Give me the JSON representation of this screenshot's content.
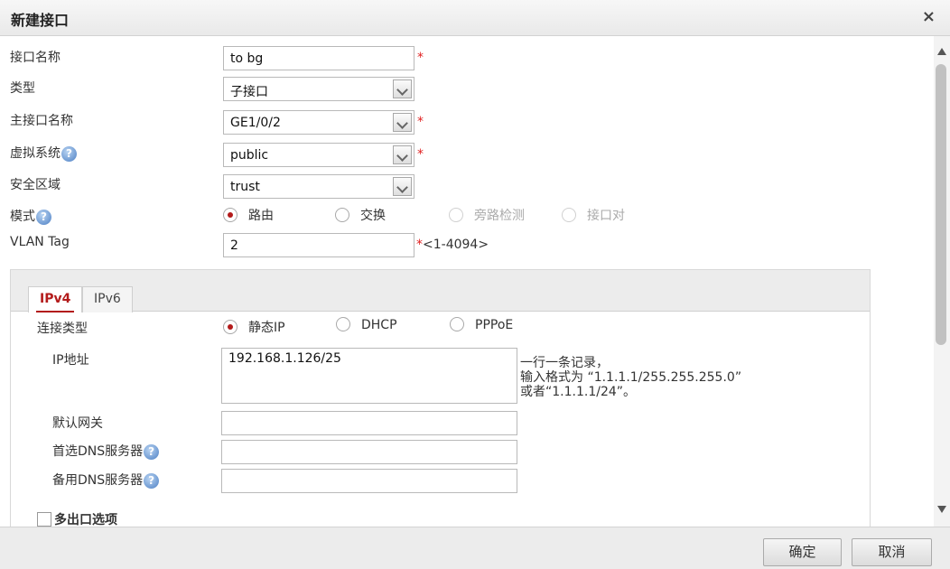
{
  "dialog": {
    "title": "新建接口",
    "close_glyph": "×"
  },
  "form": {
    "name": {
      "label": "接口名称",
      "value": "to bg",
      "required": "*"
    },
    "type": {
      "label": "类型",
      "value": "子接口"
    },
    "parent": {
      "label": "主接口名称",
      "value": "GE1/0/2",
      "required": "*"
    },
    "vsys": {
      "label": "虚拟系统",
      "value": "public",
      "required": "*"
    },
    "zone": {
      "label": "安全区域",
      "value": "trust"
    },
    "mode": {
      "label": "模式",
      "options": [
        "路由",
        "交换",
        "旁路检测",
        "接口对"
      ],
      "selected": "路由"
    },
    "vlan": {
      "label": "VLAN Tag",
      "value": "2",
      "required": "*",
      "hint": "<1-4094>"
    },
    "help_glyph": "?"
  },
  "tabs": [
    {
      "label": "IPv4",
      "active": true
    },
    {
      "label": "IPv6",
      "active": false
    }
  ],
  "ipv4": {
    "conn_type": {
      "label": "连接类型",
      "options": [
        "静态IP",
        "DHCP",
        "PPPoE"
      ],
      "selected": "静态IP"
    },
    "ip": {
      "label": "IP地址",
      "value": "192.168.1.126/25",
      "hint": [
        "一行一条记录，",
        "输入格式为 “1.1.1.1/255.255.255.0”",
        "或者“1.1.1.1/24”。"
      ]
    },
    "gateway": {
      "label": "默认网关",
      "value": ""
    },
    "dns1": {
      "label": "首选DNS服务器",
      "value": ""
    },
    "dns2": {
      "label": "备用DNS服务器",
      "value": ""
    }
  },
  "multi_exit": {
    "label": "多出口选项",
    "checked": false
  },
  "footer": {
    "ok_label": "确定",
    "cancel_label": "取消"
  },
  "colors": {
    "accent": "#b31b1b",
    "required": "#e02020",
    "help": "#4c7fc4"
  },
  "icons": {
    "close": "close-icon",
    "help": "help-icon",
    "dropdown": "chevron-down-icon"
  }
}
